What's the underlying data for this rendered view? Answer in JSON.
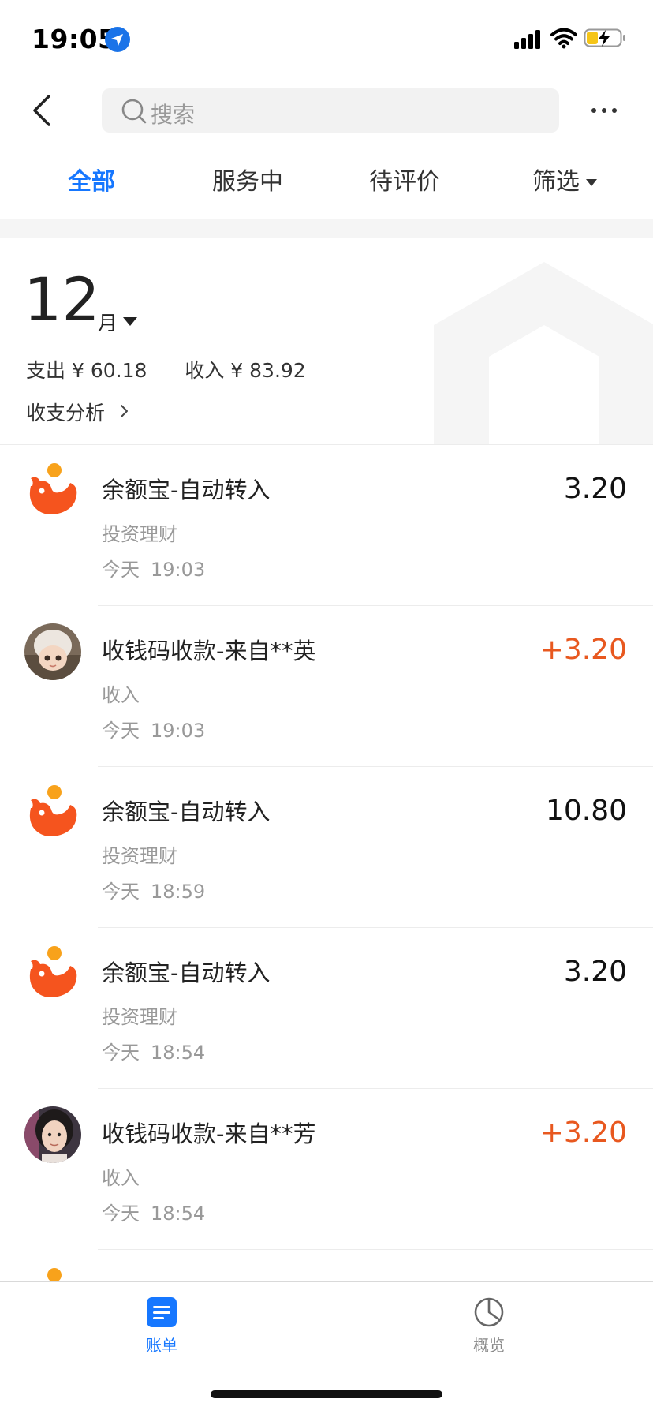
{
  "status_bar": {
    "time": "19:05"
  },
  "search": {
    "placeholder": "搜索"
  },
  "tabs": [
    {
      "label": "全部",
      "active": true
    },
    {
      "label": "服务中",
      "active": false
    },
    {
      "label": "待评价",
      "active": false
    },
    {
      "label": "筛选",
      "active": false
    }
  ],
  "summary": {
    "month": "12",
    "month_unit": "月",
    "expense_label": "支出",
    "expense_value": "¥ 60.18",
    "income_label": "收入",
    "income_value": "¥ 83.92",
    "analysis_label": "收支分析"
  },
  "transactions": [
    {
      "title": "余额宝-自动转入",
      "category": "投资理财",
      "day": "今天",
      "time": "19:03",
      "amount": "3.20",
      "type": "expense",
      "icon": "yuebao-icon"
    },
    {
      "title": "收钱码收款-来自**英",
      "category": "收入",
      "day": "今天",
      "time": "19:03",
      "amount": "+3.20",
      "type": "income",
      "icon": "avatar-doll"
    },
    {
      "title": "余额宝-自动转入",
      "category": "投资理财",
      "day": "今天",
      "time": "18:59",
      "amount": "10.80",
      "type": "expense",
      "icon": "yuebao-icon"
    },
    {
      "title": "余额宝-自动转入",
      "category": "投资理财",
      "day": "今天",
      "time": "18:54",
      "amount": "3.20",
      "type": "expense",
      "icon": "yuebao-icon"
    },
    {
      "title": "收钱码收款-来自**芳",
      "category": "收入",
      "day": "今天",
      "time": "18:54",
      "amount": "+3.20",
      "type": "income",
      "icon": "avatar-woman"
    }
  ],
  "tabbar": [
    {
      "label": "账单",
      "icon": "bill-icon",
      "active": true
    },
    {
      "label": "概览",
      "icon": "pie-chart-icon",
      "active": false
    }
  ],
  "colors": {
    "accent": "#1677ff",
    "income": "#e8581f",
    "yuebao": "#f5541e"
  }
}
